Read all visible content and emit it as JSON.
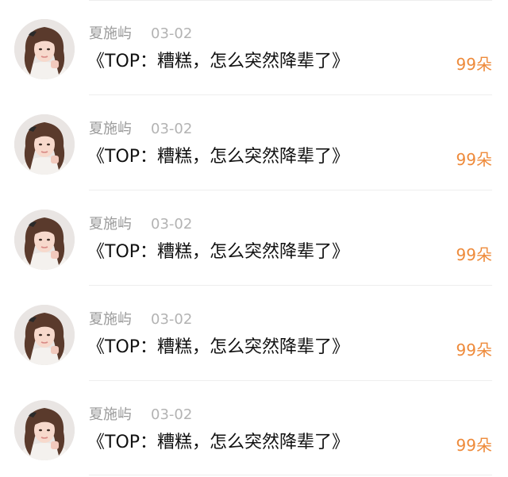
{
  "items": [
    {
      "avatar_icon": "user-avatar-photo",
      "name": "夏施屿",
      "date": "03-02",
      "title": "《TOP：糟糕，怎么突然降辈了》",
      "count": "99朵"
    },
    {
      "avatar_icon": "user-avatar-photo",
      "name": "夏施屿",
      "date": "03-02",
      "title": "《TOP：糟糕，怎么突然降辈了》",
      "count": "99朵"
    },
    {
      "avatar_icon": "user-avatar-photo",
      "name": "夏施屿",
      "date": "03-02",
      "title": "《TOP：糟糕，怎么突然降辈了》",
      "count": "99朵"
    },
    {
      "avatar_icon": "user-avatar-photo",
      "name": "夏施屿",
      "date": "03-02",
      "title": "《TOP：糟糕，怎么突然降辈了》",
      "count": "99朵"
    },
    {
      "avatar_icon": "user-avatar-photo",
      "name": "夏施屿",
      "date": "03-02",
      "title": "《TOP：糟糕，怎么突然降辈了》",
      "count": "99朵"
    }
  ],
  "colors": {
    "name": "#9a9a9a",
    "date": "#b3b3b3",
    "title": "#111111",
    "count_accent": "#ee8a3a"
  }
}
